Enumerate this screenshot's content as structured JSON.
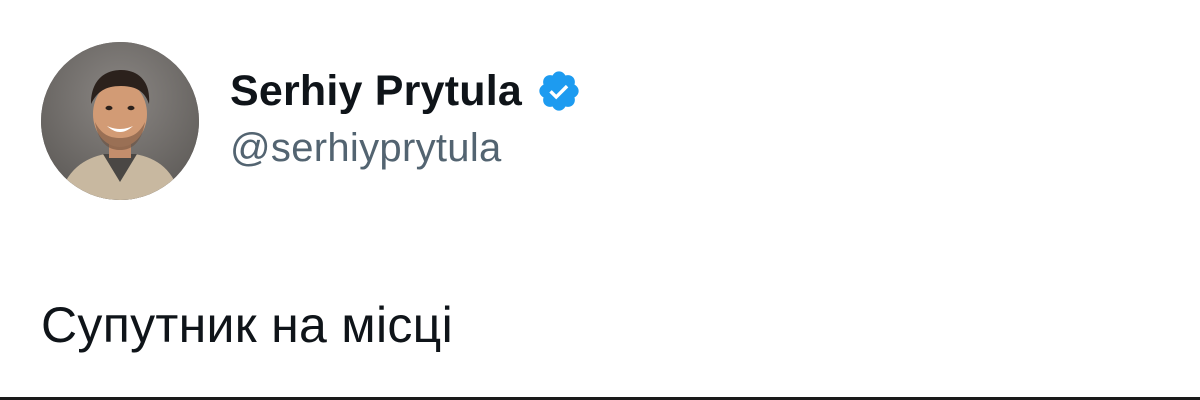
{
  "author": {
    "display_name": "Serhiy Prytula",
    "handle": "@serhiyprytula",
    "verified": true,
    "verified_icon": "verified-check-badge",
    "verified_color": "#1d9bf0"
  },
  "tweet": {
    "text": "Супутник на місці"
  },
  "colors": {
    "text_primary": "#0f1419",
    "text_secondary": "#536471",
    "background": "#ffffff"
  }
}
